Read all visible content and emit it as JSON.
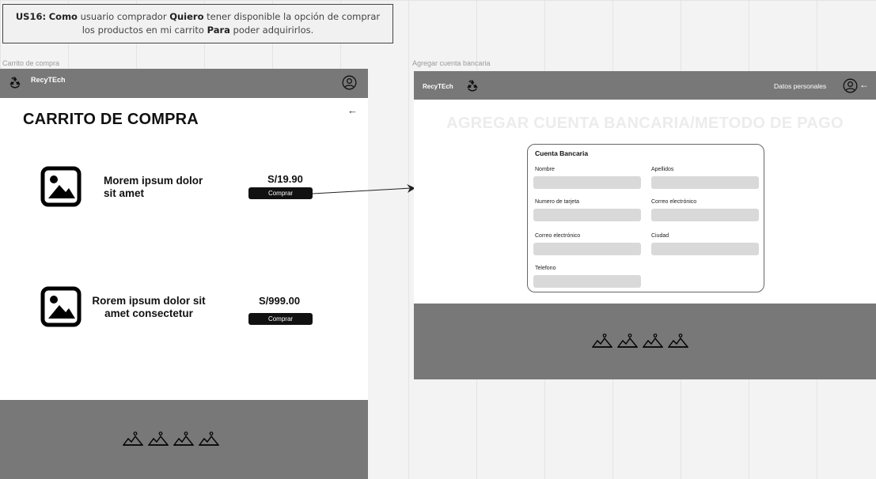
{
  "story": {
    "id": "US16:",
    "como_kw": "Como",
    "como_text": " usuario comprador ",
    "quiero_kw": "Quiero",
    "quiero_text": " tener disponible   la opción de comprar los productos en mi carrito ",
    "para_kw": "Para",
    "para_text": " poder   adquirirlos."
  },
  "frames": {
    "left_label": "Carrito de compra",
    "right_label": "Agregar cuenta bancaria"
  },
  "cart": {
    "brand": "RecyTEch",
    "title": "CARRITO DE COMPRA",
    "back_glyph": "←",
    "products": [
      {
        "name": "Morem ipsum dolor sit amet",
        "price": "S/19.90",
        "button": "Comprar"
      },
      {
        "name": "Rorem ipsum dolor sit amet consectetur",
        "price": "S/999.00",
        "button": "Comprar"
      }
    ]
  },
  "bank": {
    "brand": "RecyTEch",
    "nav_link": "Datos personales",
    "back_glyph": "←",
    "title": "AGREGAR CUENTA BANCARIA/METODO DE PAGO",
    "card_heading": "Cuenta Bancaria",
    "fields": {
      "nombre": "Nombre",
      "apellidos": "Apellidos",
      "numero_tarjeta": "Numero de tarjeta",
      "correo1": "Correo electrónico",
      "correo2": "Correo electrónico",
      "ciudad": "Ciudad",
      "telefono": "Telefono"
    }
  },
  "icons": {
    "logo": "recycle-icon",
    "user": "user-circle-icon",
    "image": "image-placeholder-icon",
    "social": "mountain-icon"
  },
  "colors": {
    "bar": "#787878",
    "button": "#111111",
    "input": "#d9d9d9",
    "faded_title": "#ececec"
  }
}
